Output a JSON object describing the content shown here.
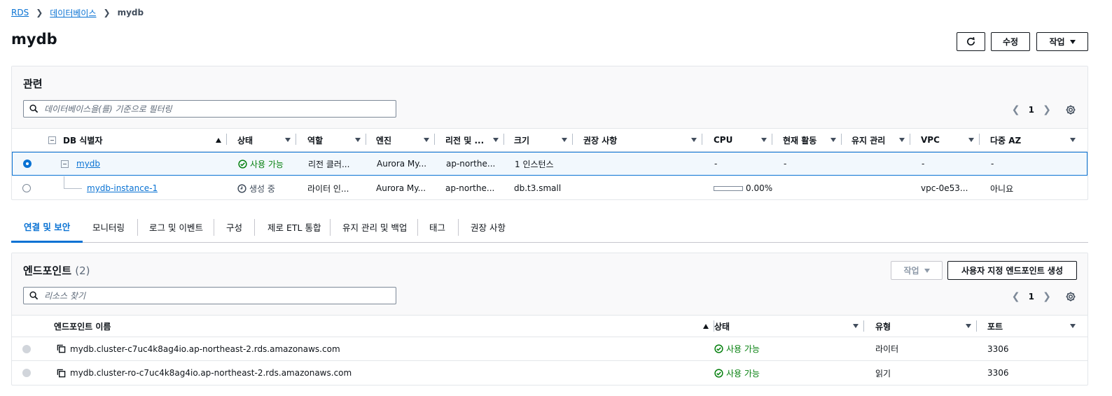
{
  "breadcrumb": {
    "rds": "RDS",
    "databases": "데이터베이스",
    "current": "mydb"
  },
  "page": {
    "title": "mydb"
  },
  "header_buttons": {
    "modify": "수정",
    "actions": "작업"
  },
  "related": {
    "title": "관련",
    "search_placeholder": "데이터베이스을(를) 기준으로 필터링",
    "page_number": "1",
    "columns": {
      "db_id": "DB 식별자",
      "status": "상태",
      "role": "역할",
      "engine": "엔진",
      "region": "리전 및 ...",
      "size": "크기",
      "recommendations": "권장 사항",
      "cpu": "CPU",
      "activity": "현재 활동",
      "maintenance": "유지 관리",
      "vpc": "VPC",
      "multi_az": "다중 AZ"
    },
    "rows": [
      {
        "db_id": "mydb",
        "status": "사용 가능",
        "role": "리전 클러...",
        "engine": "Aurora My...",
        "region": "ap-northe...",
        "size": "1 인스턴스",
        "cpu": "-",
        "activity": "-",
        "vpc": "-",
        "multi_az": "-"
      },
      {
        "db_id": "mydb-instance-1",
        "status": "생성 중",
        "role": "라이터 인...",
        "engine": "Aurora My...",
        "region": "ap-northe...",
        "size": "db.t3.small",
        "cpu": "0.00%",
        "cpu_fraction": 0.0,
        "vpc": "vpc-0e53...",
        "multi_az": "아니요"
      }
    ]
  },
  "tabs": [
    {
      "label": "연결 및 보안",
      "active": true
    },
    {
      "label": "모니터링"
    },
    {
      "label": "로그 및 이벤트"
    },
    {
      "label": "구성"
    },
    {
      "label": "제로 ETL 통합"
    },
    {
      "label": "유지 관리 및 백업"
    },
    {
      "label": "태그"
    },
    {
      "label": "권장 사항"
    }
  ],
  "endpoints": {
    "title": "엔드포인트",
    "count": "(2)",
    "actions_label": "작업",
    "create_label": "사용자 지정 엔드포인트 생성",
    "search_placeholder": "리소스 찾기",
    "page_number": "1",
    "columns": {
      "name": "엔드포인트 이름",
      "status": "상태",
      "type": "유형",
      "port": "포트"
    },
    "rows": [
      {
        "name": "mydb.cluster-c7uc4k8ag4io.ap-northeast-2.rds.amazonaws.com",
        "status": "사용 가능",
        "type": "라이터",
        "port": "3306"
      },
      {
        "name": "mydb.cluster-ro-c7uc4k8ag4io.ap-northeast-2.rds.amazonaws.com",
        "status": "사용 가능",
        "type": "읽기",
        "port": "3306"
      }
    ]
  },
  "colors": {
    "accent": "#0972d3",
    "success": "#037f0c",
    "text": "#0f141a",
    "border": "#e3e6ea"
  }
}
